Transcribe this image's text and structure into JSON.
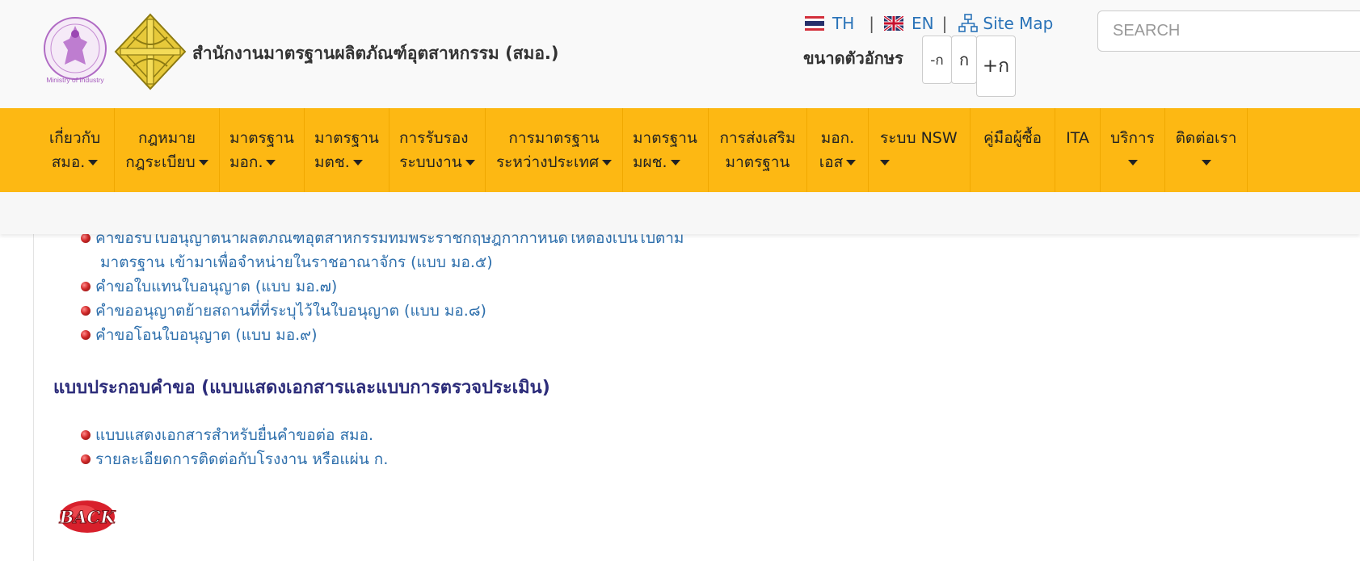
{
  "header": {
    "org_name": "สำนักงานมาตรฐานผลิตภัณฑ์อุตสาหกรรม (สมอ.)",
    "lang_th": "TH",
    "lang_sep1": "|",
    "lang_en": "EN",
    "lang_sep2": "|",
    "sitemap": "Site Map",
    "fontsize_label": "ขนาดตัวอักษร",
    "fontsize_decrease": "-ก",
    "fontsize_normal": "ก",
    "fontsize_increase": "+ก",
    "search_placeholder": "SEARCH",
    "logo_moi_text": "Ministry of Industry"
  },
  "nav": {
    "items": [
      {
        "line1": "เกี่ยวกับ",
        "line2": "สมอ."
      },
      {
        "line1": "กฎหมาย",
        "line2": "กฎระเบียบ"
      },
      {
        "line1": "มาตรฐาน",
        "line2": "มอก."
      },
      {
        "line1": "มาตรฐาน",
        "line2": "มตช."
      },
      {
        "line1": "การรับรอง",
        "line2": "ระบบงาน"
      },
      {
        "line1": "การมาตรฐาน",
        "line2": "ระหว่างประเทศ"
      },
      {
        "line1": "มาตรฐาน",
        "line2": "มผช."
      },
      {
        "line1": "การส่งเสริม",
        "line2": "มาตรฐาน"
      },
      {
        "line1": "มอก.",
        "line2": "เอส"
      },
      {
        "line1": "ระบบ NSW",
        "line2": ""
      },
      {
        "line1": "คู่มือผู้ซื้อ",
        "line2": ""
      },
      {
        "line1": "ITA",
        "line2": ""
      },
      {
        "line1": "บริการ",
        "line2": ""
      },
      {
        "line1": "ติดต่อเรา",
        "line2": ""
      }
    ]
  },
  "content": {
    "forms_list": [
      {
        "line1": "คำขอรับใบอนุญาตนำผลิตภัณฑ์อุตสาหกรรมที่มีพระราชกฤษฎีกากำหนดให้ต้องเป็นไปตาม",
        "line2": "มาตรฐาน เข้ามาเพื่อจำหน่ายในราชอาณาจักร (แบบ มอ.๕)"
      },
      {
        "line1": "คำขอใบแทนใบอนุญาต (แบบ มอ.๗)"
      },
      {
        "line1": "คำขออนุญาตย้ายสถานที่ที่ระบุไว้ในใบอนุญาต (แบบ มอ.๘)"
      },
      {
        "line1": "คำขอโอนใบอนุญาต (แบบ มอ.๙)"
      }
    ],
    "section_title": "แบบประกอบคำขอ (แบบแสดงเอกสารและแบบการตรวจประเมิน)",
    "supporting_list": [
      {
        "line1": "แบบแสดงเอกสารสำหรับยื่นคำขอต่อ สมอ."
      },
      {
        "line1": "รายละเอียดการติดต่อกับโรงงาน หรือแผ่น ก."
      }
    ],
    "back_label": "BACK"
  },
  "colors": {
    "nav_bg": "#fdb813",
    "link": "#2e6fac",
    "section_title": "#2c2c7a",
    "header_bg": "#f9f9f9"
  }
}
